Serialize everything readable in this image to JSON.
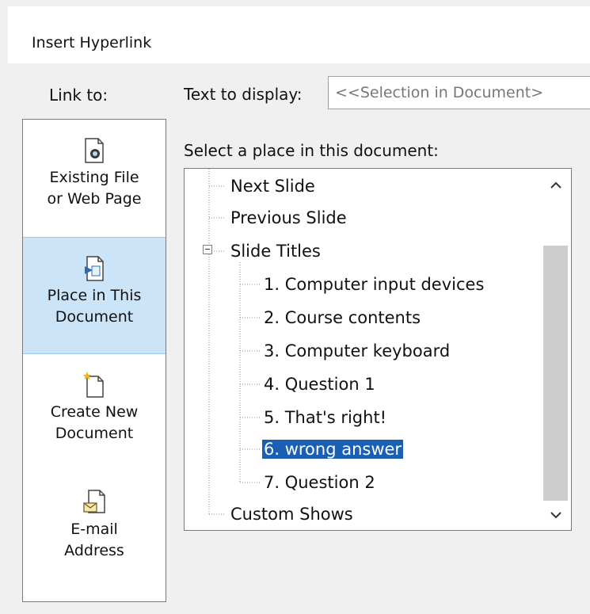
{
  "dialog": {
    "title": "Insert Hyperlink"
  },
  "link_to": {
    "label": "Link to:",
    "items": [
      {
        "id": "existing",
        "label": "Existing File\nor Web Page",
        "icon": "existing-file-icon",
        "selected": false
      },
      {
        "id": "place",
        "label": "Place in This\nDocument",
        "icon": "place-in-document-icon",
        "selected": true
      },
      {
        "id": "new",
        "label": "Create New\nDocument",
        "icon": "new-document-icon",
        "selected": false
      },
      {
        "id": "email",
        "label": "E-mail\nAddress",
        "icon": "email-icon",
        "selected": false
      }
    ]
  },
  "text_to_display": {
    "label": "Text to display:",
    "value": "<<Selection in Document>"
  },
  "place_select": {
    "label": "Select a place in this document:"
  },
  "tree": {
    "nodes": [
      {
        "label": "Next Slide",
        "level": 0,
        "selected": false
      },
      {
        "label": "Previous Slide",
        "level": 0,
        "selected": false
      },
      {
        "label": "Slide Titles",
        "level": 0,
        "selected": false,
        "expandable": true
      },
      {
        "label": "1. Computer  input devices",
        "level": 1,
        "selected": false
      },
      {
        "label": "2. Course contents",
        "level": 1,
        "selected": false
      },
      {
        "label": "3. Computer keyboard",
        "level": 1,
        "selected": false
      },
      {
        "label": "4. Question 1",
        "level": 1,
        "selected": false
      },
      {
        "label": "5. That's right!",
        "level": 1,
        "selected": false
      },
      {
        "label": "6. wrong answer",
        "level": 1,
        "selected": true
      },
      {
        "label": "7. Question 2",
        "level": 1,
        "selected": false
      },
      {
        "label": "Custom Shows",
        "level": 0,
        "selected": false
      }
    ]
  },
  "colors": {
    "selection": "#1a5fb4",
    "linkto_selected": "#cce4f7"
  }
}
